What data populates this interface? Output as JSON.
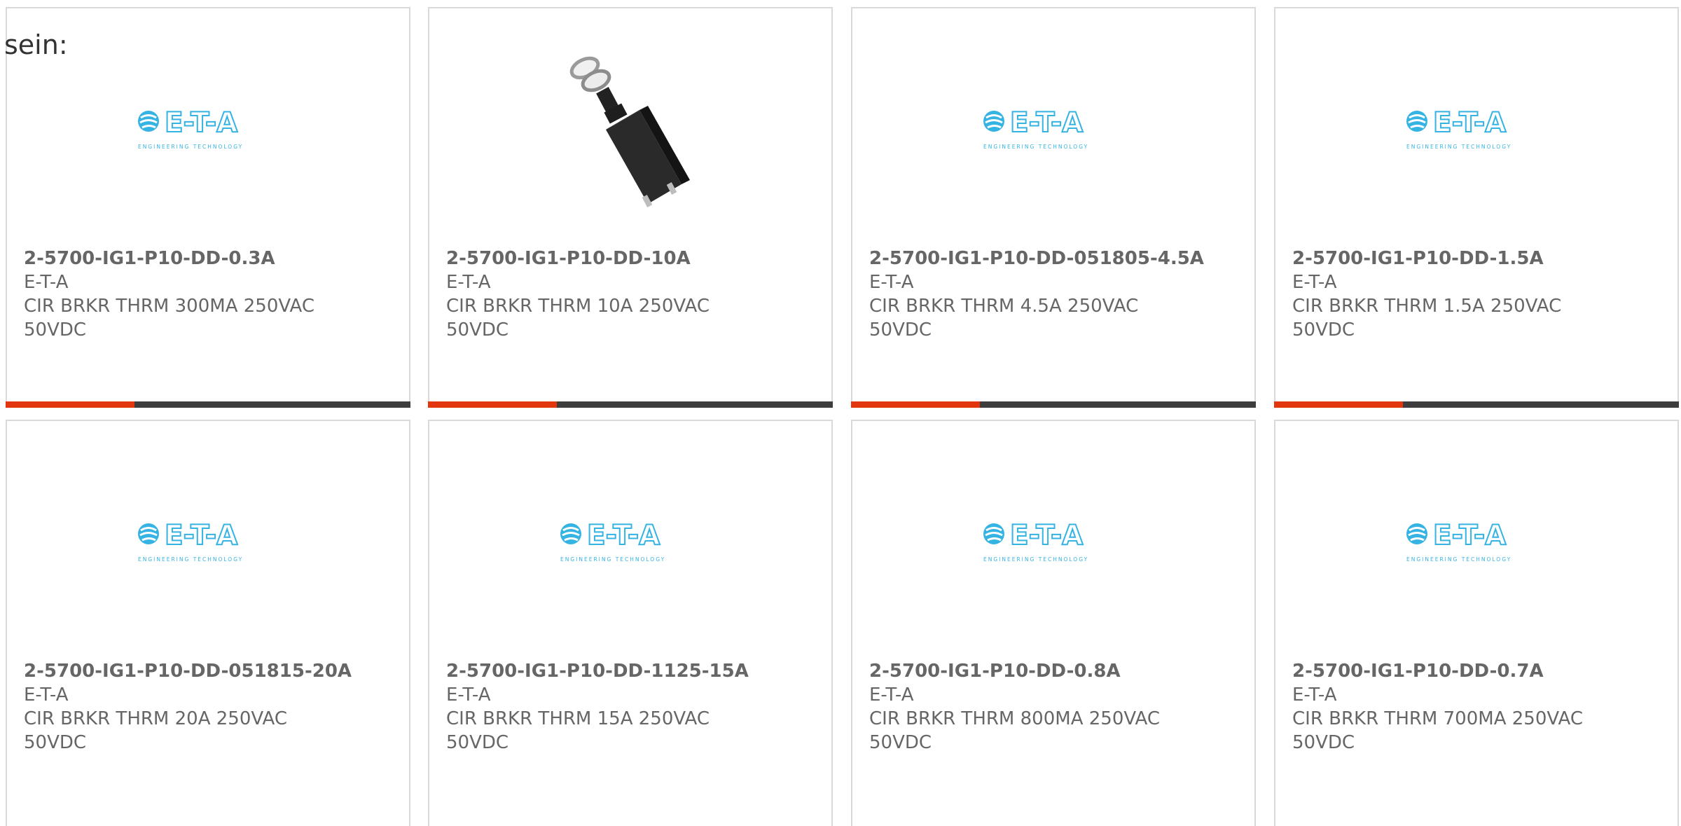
{
  "intro_text": "sein:",
  "products": [
    {
      "part": "2-5700-IG1-P10-DD-0.3A",
      "maker": "E-T-A",
      "desc": "CIR BRKR THRM 300MA 250VAC 50VDC",
      "image": "eta-logo"
    },
    {
      "part": "2-5700-IG1-P10-DD-10A",
      "maker": "E-T-A",
      "desc": "CIR BRKR THRM 10A 250VAC 50VDC",
      "image": "breaker-photo"
    },
    {
      "part": "2-5700-IG1-P10-DD-051805-4.5A",
      "maker": "E-T-A",
      "desc": "CIR BRKR THRM 4.5A 250VAC 50VDC",
      "image": "eta-logo"
    },
    {
      "part": "2-5700-IG1-P10-DD-1.5A",
      "maker": "E-T-A",
      "desc": "CIR BRKR THRM 1.5A 250VAC 50VDC",
      "image": "eta-logo"
    },
    {
      "part": "2-5700-IG1-P10-DD-051815-20A",
      "maker": "E-T-A",
      "desc": "CIR BRKR THRM 20A 250VAC 50VDC",
      "image": "eta-logo"
    },
    {
      "part": "2-5700-IG1-P10-DD-1125-15A",
      "maker": "E-T-A",
      "desc": "CIR BRKR THRM 15A 250VAC 50VDC",
      "image": "eta-logo"
    },
    {
      "part": "2-5700-IG1-P10-DD-0.8A",
      "maker": "E-T-A",
      "desc": "CIR BRKR THRM 800MA 250VAC 50VDC",
      "image": "eta-logo"
    },
    {
      "part": "2-5700-IG1-P10-DD-0.7A",
      "maker": "E-T-A",
      "desc": "CIR BRKR THRM 700MA 250VAC 50VDC",
      "image": "eta-logo"
    }
  ],
  "logo": {
    "brand": "E-T-A",
    "tagline": "ENGINEERING TECHNOLOGY"
  },
  "colors": {
    "accent": "#e2360f",
    "bar": "#3d3d3d",
    "logo_blue": "#35b3e3",
    "text": "#666666"
  }
}
